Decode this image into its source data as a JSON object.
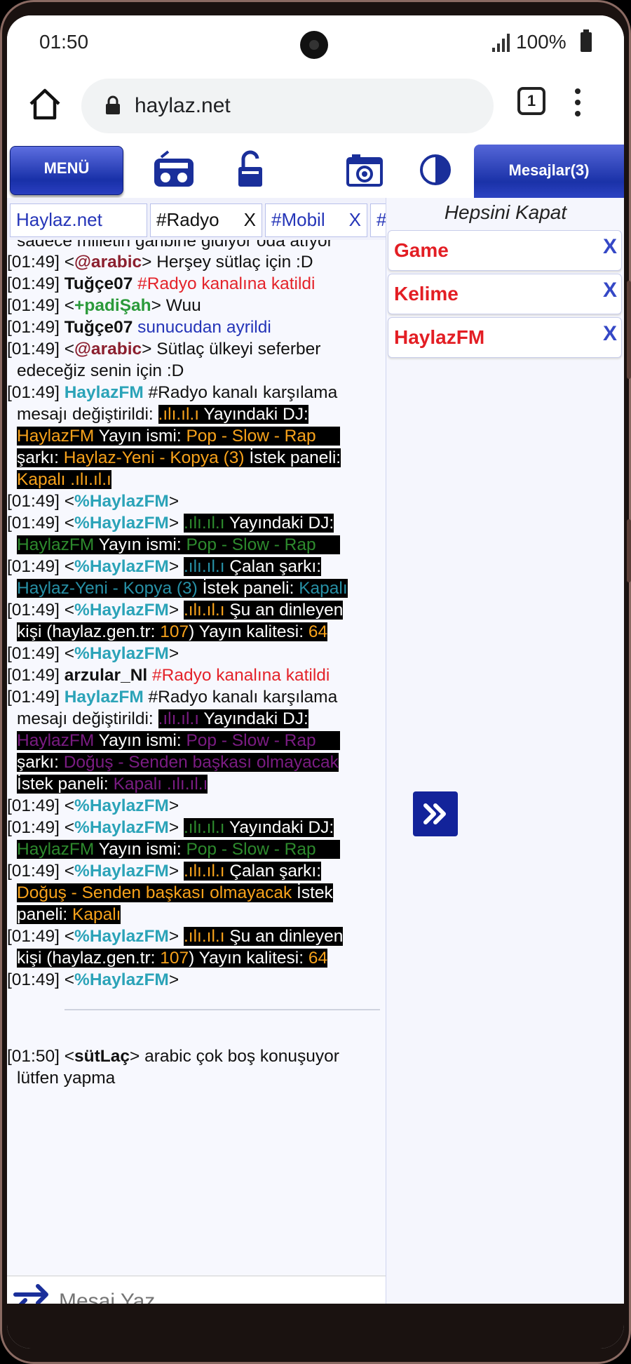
{
  "status": {
    "time": "01:50",
    "battery": "100%"
  },
  "browser": {
    "url": "haylaz.net",
    "tab_count": "1"
  },
  "toolbar": {
    "menu_label": "MENÜ",
    "messages_label": "Mesajlar(3)"
  },
  "channel_tabs": [
    {
      "label": "Haylaz.net",
      "close": ""
    },
    {
      "label": "#Radyo",
      "close": "X"
    },
    {
      "label": "#Mobil",
      "close": "X"
    },
    {
      "label": "#",
      "close": ""
    }
  ],
  "chat": {
    "l0": "sadece milletin garibine gidiyor oda atıyor",
    "l1a": "[01:49] <",
    "l1n": "@arabic",
    "l1b": "> Herşey sütlaç için :D",
    "l2a": "[01:49] ",
    "l2n": "Tuğçe07",
    "l2b": " #Radyo kanalına katildi",
    "l3a": "[01:49] <",
    "l3n": "+padiŞah",
    "l3b": "> Wuu",
    "l4a": "[01:49] ",
    "l4n": "Tuğçe07",
    "l4b": " sunucudan ayrildi",
    "l5a": "[01:49] <",
    "l5n": "@arabic",
    "l5b": "> Sütlaç ülkeyi seferber",
    "l6": "edeceğiz senin için :D",
    "l7a": "[01:49] ",
    "l7n": "HaylazFM",
    "l7b": " #Radyo kanalı karşılama",
    "l8a": "mesajı değiştirildi: ",
    "l8b": ".ılı.ıl.ı",
    "l8c": " Yayındaki DJ:",
    "l9a": "HaylazFM",
    "l9b": " Yayın ismi: ",
    "l9c": "Pop - Slow - Rap",
    "l10a": "şarkı: ",
    "l10b": "Haylaz-Yeni - Kopya (3)",
    "l10c": " İstek paneli:",
    "l11": "Kapalı .ılı.ıl.ı",
    "l12a": "[01:49] <",
    "l12n": "%HaylazFM",
    "l12b": ">",
    "l13a": "[01:49] <",
    "l13n": "%HaylazFM",
    "l13b": "> ",
    "l13c": ".ılı.ıl.ı",
    "l13d": " Yayındaki DJ:",
    "l14a": "HaylazFM",
    "l14b": " Yayın ismi: ",
    "l14c": "Pop - Slow - Rap",
    "l15a": "[01:49] <",
    "l15n": "%HaylazFM",
    "l15b": "> ",
    "l15c": ".ılı.ıl.ı",
    "l15d": " Çalan şarkı:",
    "l16a": "Haylaz-Yeni - Kopya (3)",
    "l16b": " İstek paneli: ",
    "l16c": "Kapalı",
    "l17a": "[01:49] <",
    "l17n": "%HaylazFM",
    "l17b": "> ",
    "l17c": ".ılı.ıl.ı",
    "l17d": " Şu an dinleyen",
    "l18a": "kişi (haylaz.gen.tr: ",
    "l18b": "107",
    "l18c": ") Yayın kalitesi: ",
    "l18d": "64",
    "l19a": "[01:49] <",
    "l19n": "%HaylazFM",
    "l19b": ">",
    "l20a": "[01:49] ",
    "l20n": "arzular_Nl",
    "l20b": " #Radyo kanalına katildi",
    "l21a": "[01:49] ",
    "l21n": "HaylazFM",
    "l21b": " #Radyo kanalı karşılama",
    "l22a": "mesajı değiştirildi: ",
    "l22b": ".ılı.ıl.ı",
    "l22c": " Yayındaki DJ:",
    "l23a": "HaylazFM",
    "l23b": " Yayın ismi: ",
    "l23c": "Pop - Slow - Rap",
    "l24a": "şarkı: ",
    "l24b": "Doğuş - Senden başkası olmayacak",
    "l25a": "İstek paneli: ",
    "l25b": "Kapalı .ılı.ıl.ı",
    "l26a": "[01:49] <",
    "l26n": "%HaylazFM",
    "l26b": ">",
    "l27a": "[01:49] <",
    "l27n": "%HaylazFM",
    "l27b": "> ",
    "l27c": ".ılı.ıl.ı",
    "l27d": " Yayındaki DJ:",
    "l28a": "HaylazFM",
    "l28b": " Yayın ismi: ",
    "l28c": "Pop - Slow - Rap",
    "l29a": "[01:49] <",
    "l29n": "%HaylazFM",
    "l29b": "> ",
    "l29c": ".ılı.ıl.ı",
    "l29d": " Çalan şarkı:",
    "l30a": "Doğuş - Senden başkası olmayacak",
    "l30b": " İstek",
    "l31a": "paneli: ",
    "l31b": "Kapalı",
    "l32a": "[01:49] <",
    "l32n": "%HaylazFM",
    "l32b": "> ",
    "l32c": ".ılı.ıl.ı",
    "l32d": " Şu an dinleyen",
    "l33a": "kişi (haylaz.gen.tr: ",
    "l33b": "107",
    "l33c": ") Yayın kalitesi: ",
    "l33d": "64",
    "l34a": "[01:49] <",
    "l34n": "%HaylazFM",
    "l34b": ">",
    "l35a": "[01:50] <",
    "l35n": "sütLaç",
    "l35b": "> arabic çok boş konuşuyor",
    "l36": "lütfen yapma"
  },
  "input": {
    "placeholder": "Mesaj Yaz."
  },
  "panel": {
    "title": "Hepsini Kapat",
    "items": [
      {
        "label": "Game",
        "close": "X"
      },
      {
        "label": "Kelime",
        "close": "X"
      },
      {
        "label": "HaylazFM",
        "close": "X"
      }
    ]
  },
  "colors": {
    "accent": "#1a32a8",
    "nick_halfop": "#2ba3b8",
    "join": "#e4232a",
    "quit": "#2535b8"
  }
}
